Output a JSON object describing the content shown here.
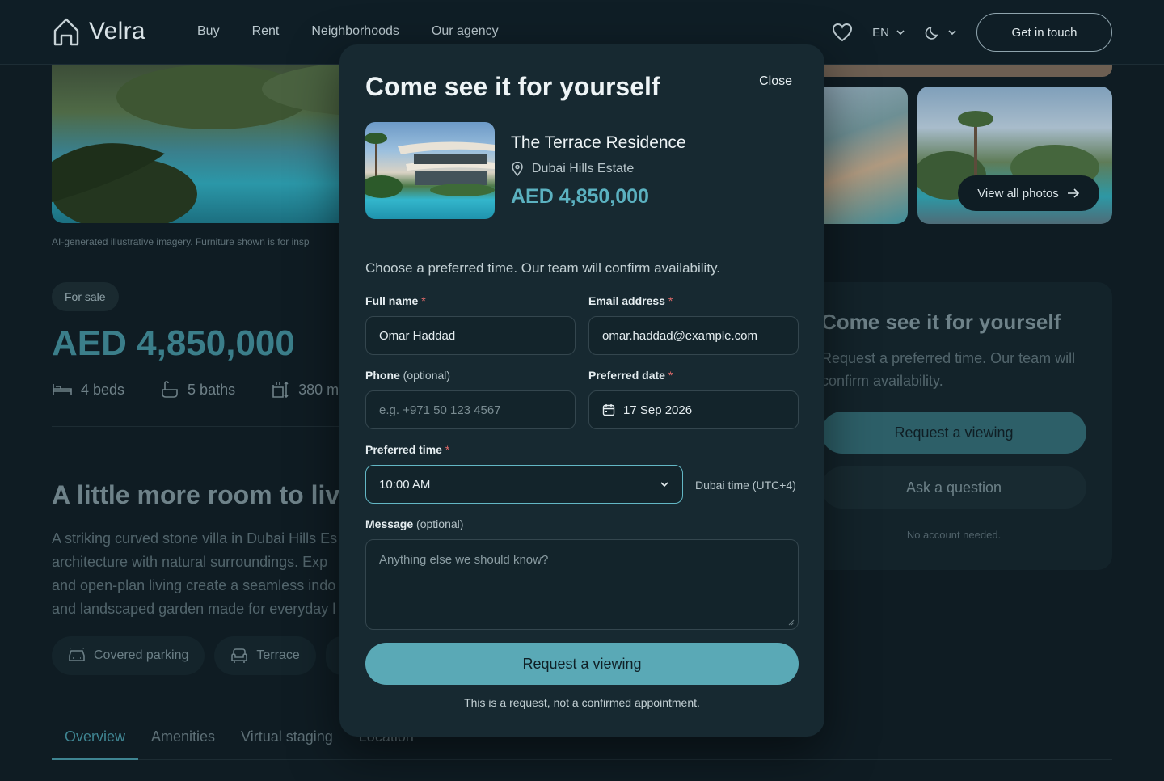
{
  "header": {
    "logo": "Velra",
    "nav": [
      "Buy",
      "Rent",
      "Neighborhoods",
      "Our agency"
    ],
    "language": "EN",
    "cta": "Get in touch"
  },
  "gallery": {
    "view_all": "View all photos",
    "ai_note": "AI-generated illustrative imagery. Furniture shown is for insp"
  },
  "listing": {
    "badge": "For sale",
    "price": "AED 4,850,000",
    "beds": "4 beds",
    "baths": "5 baths",
    "area": "380 m",
    "section_title": "A little more room to live",
    "description": [
      "A striking curved stone villa in Dubai Hills Es",
      "architecture with natural surroundings. Exp",
      "and open-plan living create a seamless indo",
      "and landscaped garden made for everyday l"
    ],
    "amenities": [
      "Covered parking",
      "Terrace"
    ],
    "tabs": [
      "Overview",
      "Amenities",
      "Virtual staging",
      "Location"
    ]
  },
  "side_card": {
    "title": "Come see it for yourself",
    "subtitle": "Request a preferred time. Our team will confirm availability.",
    "primary": "Request a viewing",
    "secondary": "Ask a question",
    "note": "No account needed."
  },
  "modal": {
    "title": "Come see it for yourself",
    "close": "Close",
    "property_name": "The Terrace Residence",
    "location": "Dubai Hills Estate",
    "price": "AED 4,850,000",
    "intro": "Choose a preferred time. Our team will confirm availability.",
    "full_name": {
      "label": "Full name",
      "value": "Omar Haddad"
    },
    "email": {
      "label": "Email address",
      "value": "omar.haddad@example.com"
    },
    "phone": {
      "label": "Phone",
      "optional": "(optional)",
      "placeholder": "e.g. +971 50 123 4567"
    },
    "date": {
      "label": "Preferred date",
      "value": "17 Sep 2026"
    },
    "time": {
      "label": "Preferred time",
      "value": "10:00 AM",
      "timezone": "Dubai time (UTC+4)"
    },
    "message": {
      "label": "Message",
      "optional": "(optional)",
      "placeholder": "Anything else we should know?"
    },
    "submit": "Request a viewing",
    "note": "This is a request, not a confirmed appointment."
  },
  "colors": {
    "accent": "#5aa9b6",
    "price": "#5bb1c0",
    "background": "#0f1c23",
    "modal": "#172931"
  }
}
